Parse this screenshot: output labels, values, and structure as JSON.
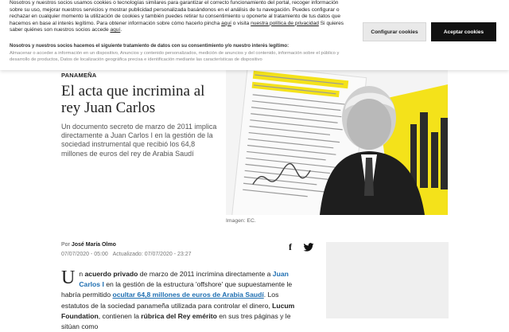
{
  "cookie_banner": {
    "text_before_link1": "Nosotros y nuestros socios usamos cookies o tecnologías similares para garantizar el correcto funcionamiento del portal, recoger información sobre su uso, mejorar nuestros servicios y mostrar publicidad personalizada basándonos en el análisis de tu navegación. Puedes configurar o rechazar en cualquier momento la utilización de cookies y también puedes retirar tu consentimiento u oponerte al tratamiento de tus datos que hacemos en base al interés legítimo. Para obtener información sobre cómo hacerlo pincha ",
    "link1": "aquí",
    "text_mid": " o visita ",
    "link2": "nuestra política de privacidad",
    "text_before_link3": " Si quieres saber quiénes son nuestros socios accede ",
    "link3": "aquí",
    "text_end": ".",
    "purpose_title": "Nosotros y nuestros socios hacemos el siguiente tratamiento de datos con su consentimiento y/o nuestro interés legítimo:",
    "purpose_text": "Almacenar o acceder a información en un dispositivo, Anuncios y contenido personalizados, medición de anuncios y del contenido, información sobre el público y desarrollo de productos, Datos de localización geográfica precisa e identificación mediante las características de dispositivo",
    "configure_label": "Configurar cookies",
    "accept_label": "Aceptar cookies"
  },
  "article": {
    "section": "PANAMEÑA",
    "headline": "El acta que incrimina al rey Juan Carlos",
    "subhead": "Un documento secreto de marzo de 2011 implica directamente a Juan Carlos I en la gestión de la sociedad instrumental que recibió los 64,8 millones de euros del rey de Arabia Saudí",
    "image_caption": "Imagen: EC.",
    "author_prefix": "Por",
    "author": "José María Olmo",
    "published": "07/07/2020 - 05:00",
    "updated_prefix": "Actualizado:",
    "updated": "07/07/2020 - 23:27",
    "body": {
      "dropcap": "U",
      "t1": "n ",
      "b1": "acuerdo privado",
      "t2": " de marzo de 2011 incrimina directamente a ",
      "link1": "Juan Carlos I",
      "t3": " en la gestión de la estructura 'offshore' que supuestamente le habría permitido ",
      "link2": "ocultar 64,8 millones de euros de Arabia Saudí",
      "t4": ". Los estatutos de la sociedad panameña utilizada para controlar el dinero, ",
      "b2": "Lucum Foundation",
      "t5": ", contienen la ",
      "b3": "rúbrica del Rey emérito",
      "t6": " en sus tres páginas y le sitúan como"
    }
  },
  "icons": {
    "share_facebook": "facebook-icon",
    "share_twitter": "twitter-icon"
  },
  "colors": {
    "link_blue": "#1f6fb2",
    "accept_button": "#111111",
    "configure_button": "#e9e9e9",
    "highlight_yellow": "#f4e21a"
  }
}
